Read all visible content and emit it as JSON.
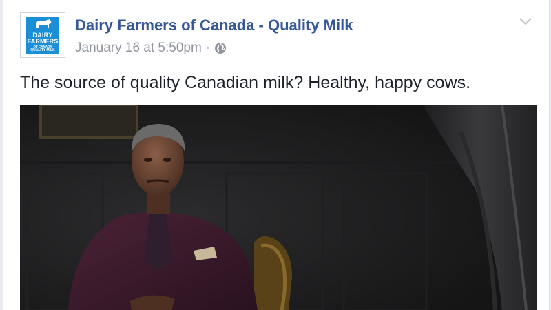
{
  "post": {
    "page_name": "Dairy Farmers of Canada - Quality Milk",
    "timestamp": "January 16 at 5:50pm",
    "separator": "·",
    "privacy_icon": "globe-icon",
    "options_icon": "chevron-down-icon",
    "text": "The source of quality Canadian milk? Healthy, happy cows."
  },
  "avatar": {
    "logo_line1": "DAIRY",
    "logo_line2": "FARMERS",
    "logo_line3": "OF CANADA",
    "logo_line4": "QUALITY MILK",
    "logo_color": "#1a8fd6"
  },
  "colors": {
    "link": "#365899",
    "meta": "#90949c",
    "text": "#1d2129"
  }
}
